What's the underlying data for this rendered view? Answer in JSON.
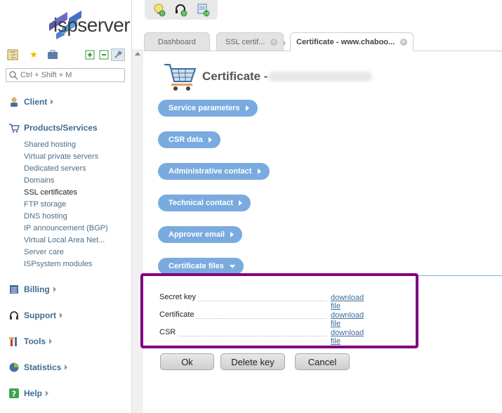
{
  "brand": {
    "name": "ispserver",
    "accent": "#7aabdf",
    "link": "#3f6e98",
    "highlight": "#800080"
  },
  "toolbar_icons": [
    "notification-bulb-icon",
    "support-headset-icon",
    "messages-icon"
  ],
  "toolbar_badges": [
    "0",
    "0",
    "16"
  ],
  "sidebar": {
    "search_placeholder": "Ctrl + Shift + M",
    "client": "Client",
    "products": "Products/Services",
    "products_items": [
      "Shared hosting",
      "Virtual private servers",
      "Dedicated servers",
      "Domains",
      "SSL certificates",
      "FTP storage",
      "DNS hosting",
      "IP announcement (BGP)",
      "Virtual Local Area Net...",
      "Server care",
      "ISPsystem modules"
    ],
    "billing": "Billing",
    "support": "Support",
    "tools": "Tools",
    "statistics": "Statistics",
    "help": "Help"
  },
  "tabs": [
    "Dashboard",
    "SSL certif...",
    "Certificate - www.chaboo..."
  ],
  "page": {
    "title": "Certificate -",
    "sections": [
      "Service parameters",
      "CSR data",
      "Administrative contact",
      "Technical contact",
      "Approver email",
      "Certificate files"
    ],
    "files": [
      {
        "label": "Secret key",
        "link": "download file"
      },
      {
        "label": "Certificate",
        "link": "download file"
      },
      {
        "label": "CSR",
        "link": "download file"
      }
    ],
    "buttons": {
      "ok": "Ok",
      "delete_key": "Delete key",
      "cancel": "Cancel"
    }
  }
}
